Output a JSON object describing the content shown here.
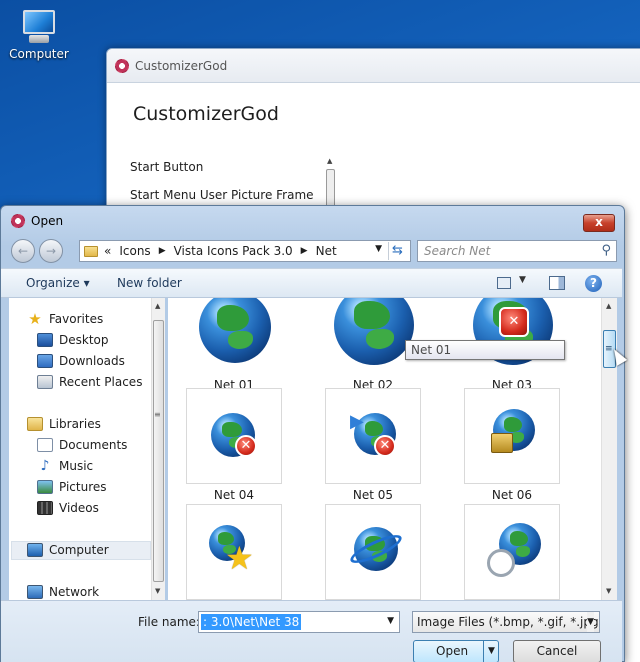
{
  "desktop": {
    "computer_label": "Computer"
  },
  "bg_window": {
    "title": "CustomizerGod",
    "heading": "CustomizerGod",
    "list": [
      "Start Button",
      "Start Menu User Picture Frame"
    ]
  },
  "dialog": {
    "title": "Open",
    "close_label": "x",
    "nav_back": "←",
    "nav_forward": "→",
    "breadcrumb": [
      "«",
      "Icons",
      "Vista Icons Pack 3.0",
      "Net"
    ],
    "search_placeholder": "Search Net",
    "toolbar": {
      "organize": "Organize",
      "new_folder": "New folder",
      "help": "?"
    },
    "nav": {
      "favorites": "Favorites",
      "desktop": "Desktop",
      "downloads": "Downloads",
      "recent": "Recent Places",
      "libraries": "Libraries",
      "documents": "Documents",
      "music": "Music",
      "pictures": "Pictures",
      "videos": "Videos",
      "computer": "Computer",
      "network": "Network"
    },
    "files": [
      "Net 01",
      "Net 02",
      "Net 03",
      "Net 04",
      "Net 05",
      "Net 06"
    ],
    "tooltip": "Net 01",
    "file_name_label": "File name:",
    "file_name_value": ": 3.0\\Net\\Net 38",
    "filter": "Image Files (*.bmp, *.gif, *.jpg,",
    "open_label": "Open",
    "cancel_label": "Cancel"
  },
  "colors": {
    "desktop_blue": "#1565c0",
    "selection": "#3399ff",
    "close_red": "#c7412b"
  }
}
